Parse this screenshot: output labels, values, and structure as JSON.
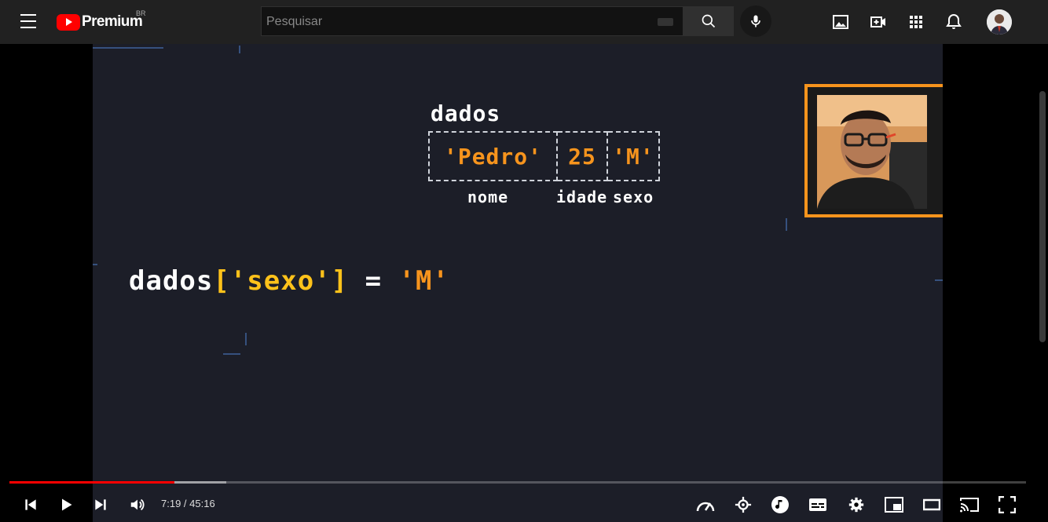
{
  "header": {
    "brand": "Premium",
    "country": "BR",
    "search_placeholder": "Pesquisar",
    "icons": [
      "menu-icon",
      "youtube-logo-icon",
      "keyboard-icon",
      "search-icon",
      "mic-icon",
      "image-icon",
      "create-video-icon",
      "apps-grid-icon",
      "bell-icon",
      "avatar"
    ]
  },
  "video": {
    "array_title": "dados",
    "cells": [
      "'Pedro'",
      "25",
      "'M'"
    ],
    "labels": [
      "nome",
      "idade",
      "sexo"
    ],
    "code": {
      "name": "dados",
      "open": "['sexo']",
      "eq": " = ",
      "value": "'M'"
    },
    "colors": {
      "background": "#1c1e28",
      "accent_orange": "#f7941d",
      "accent_yellow": "#ffc21a",
      "webcam_border": "#f7941d"
    }
  },
  "player": {
    "time_display": "7:19 / 45:16",
    "progress_fraction": 0.162,
    "buffered_fraction": 0.213,
    "progress_color": "#ff0000",
    "controls": [
      "previous-icon",
      "play-icon",
      "next-icon",
      "volume-icon",
      "speed-icon",
      "settings-sparkle-icon",
      "music-icon",
      "subtitles-icon",
      "settings-icon",
      "miniplayer-icon",
      "theater-icon",
      "cast-icon",
      "fullscreen-icon"
    ]
  }
}
